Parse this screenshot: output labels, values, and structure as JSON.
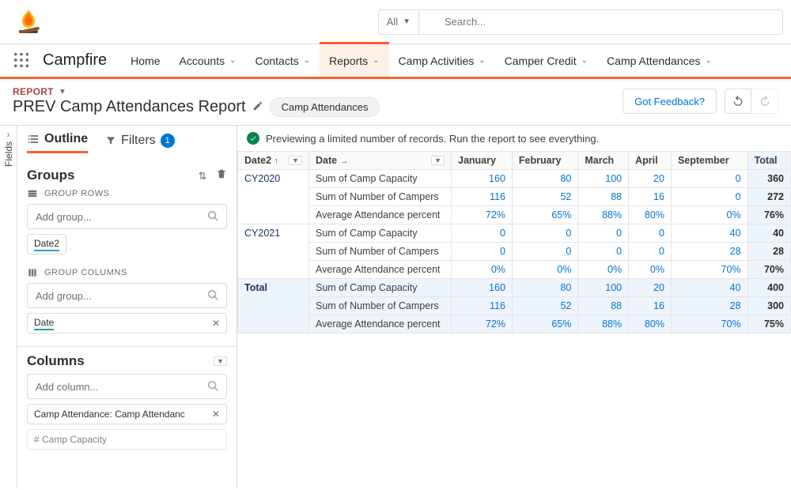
{
  "topbar": {
    "search_scope": "All",
    "search_placeholder": "Search..."
  },
  "app_name": "Campfire",
  "nav": {
    "items": [
      "Home",
      "Accounts",
      "Contacts",
      "Reports",
      "Camp Activities",
      "Camper Credit",
      "Camp Attendances"
    ],
    "active_index": 3
  },
  "page": {
    "crumb": "REPORT",
    "title": "PREV Camp Attendances Report",
    "pill": "Camp Attendances",
    "feedback_btn": "Got Feedback?"
  },
  "fields_rail": "Fields",
  "side": {
    "tabs": {
      "outline": "Outline",
      "filters": "Filters",
      "filter_count": "1"
    },
    "groups_title": "Groups",
    "group_rows_label": "GROUP ROWS",
    "add_group_placeholder": "Add group...",
    "group_row_chip": "Date2",
    "group_cols_label": "GROUP COLUMNS",
    "group_col_chip": "Date",
    "columns_title": "Columns",
    "add_column_placeholder": "Add column...",
    "column_chips": [
      "Camp Attendance: Camp Attendanc",
      "# Camp Capacity"
    ]
  },
  "preview_msg": "Previewing a limited number of records. Run the report to see everything.",
  "table": {
    "col_group_labels": {
      "date2": "Date2",
      "date": "Date"
    },
    "months": [
      "January",
      "February",
      "March",
      "April",
      "September"
    ],
    "total_label": "Total",
    "metric_labels": [
      "Sum of Camp Capacity",
      "Sum of Number of Campers",
      "Average Attendance percent"
    ],
    "rows": [
      {
        "group": "CY2020",
        "metrics": [
          {
            "values": [
              "160",
              "80",
              "100",
              "20",
              "0"
            ],
            "total": "360"
          },
          {
            "values": [
              "116",
              "52",
              "88",
              "16",
              "0"
            ],
            "total": "272"
          },
          {
            "values": [
              "72%",
              "65%",
              "88%",
              "80%",
              "0%"
            ],
            "total": "76%"
          }
        ]
      },
      {
        "group": "CY2021",
        "metrics": [
          {
            "values": [
              "0",
              "0",
              "0",
              "0",
              "40"
            ],
            "total": "40"
          },
          {
            "values": [
              "0",
              "0",
              "0",
              "0",
              "28"
            ],
            "total": "28"
          },
          {
            "values": [
              "0%",
              "0%",
              "0%",
              "0%",
              "70%"
            ],
            "total": "70%"
          }
        ]
      }
    ],
    "grand_total": {
      "label": "Total",
      "metrics": [
        {
          "values": [
            "160",
            "80",
            "100",
            "20",
            "40"
          ],
          "total": "400"
        },
        {
          "values": [
            "116",
            "52",
            "88",
            "16",
            "28"
          ],
          "total": "300"
        },
        {
          "values": [
            "72%",
            "65%",
            "88%",
            "80%",
            "70%"
          ],
          "total": "75%"
        }
      ]
    }
  }
}
